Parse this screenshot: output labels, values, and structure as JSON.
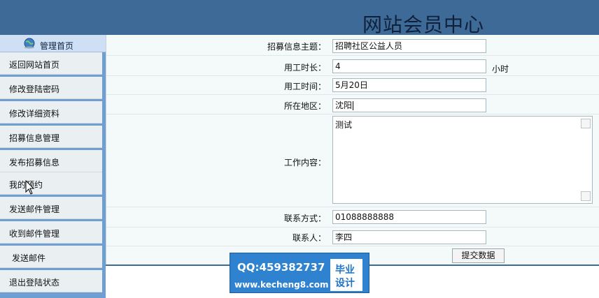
{
  "header": {
    "site_title": "网站会员中心"
  },
  "sidebar": {
    "title": "管理首页",
    "items": [
      {
        "label": "返回网站首页"
      },
      {
        "label": "修改登陆密码"
      },
      {
        "label": "修改详细资料"
      },
      {
        "label": "招募信息管理"
      },
      {
        "label": "发布招募信息"
      },
      {
        "label": "我的预约"
      },
      {
        "label": "发送邮件管理"
      },
      {
        "label": "收到邮件管理"
      },
      {
        "label": "发送邮件"
      },
      {
        "label": "退出登陆状态"
      }
    ]
  },
  "form": {
    "subject_label": "招募信息主题：",
    "subject_value": "招聘社区公益人员",
    "duration_label": "用工时长：",
    "duration_value": "4",
    "duration_unit": "小时",
    "time_label": "用工时间：",
    "time_value": "5月20日",
    "region_label": "所在地区：",
    "region_value": "沈阳",
    "content_label": "工作内容：",
    "content_value": "测试",
    "contact_label": "联系方式：",
    "contact_value": "01088888888",
    "person_label": "联系人：",
    "person_value": "李四",
    "submit_label": "提交数据"
  },
  "watermark": {
    "qq": "QQ:459382737",
    "url": "www.kecheng8.com",
    "badge_line1": "毕业",
    "badge_line2": "设计"
  },
  "colors": {
    "banner": "#3d6a96",
    "sidebar": "#6f9fd2",
    "watermark": "#2e82cf"
  }
}
